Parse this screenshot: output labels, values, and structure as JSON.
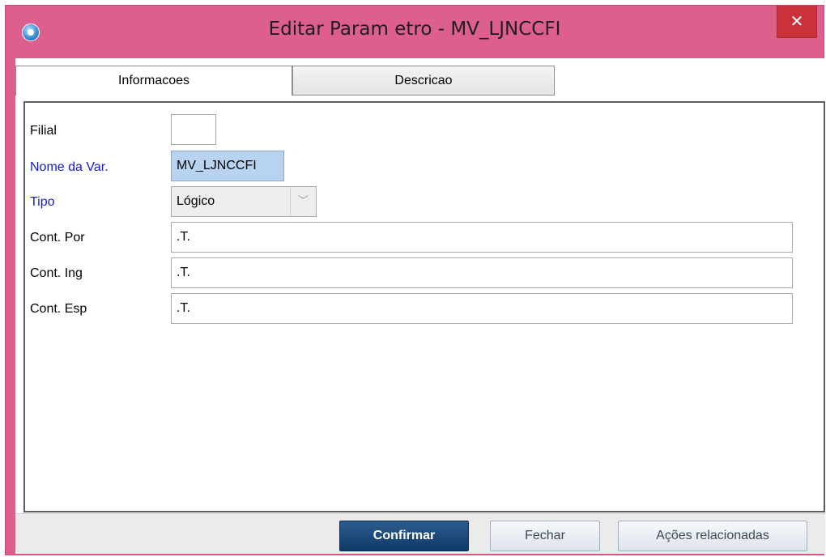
{
  "window": {
    "title": "Editar Param etro - MV_LJNCCFI",
    "close_glyph": "✕"
  },
  "tabs": [
    {
      "label": "Informacoes",
      "active": true
    },
    {
      "label": "Descricao",
      "active": false
    }
  ],
  "form": {
    "filial": {
      "label": "Filial",
      "value": ""
    },
    "nome_var": {
      "label": "Nome da Var.",
      "value": "MV_LJNCCFI"
    },
    "tipo": {
      "label": "Tipo",
      "value": "Lógico"
    },
    "cont_por": {
      "label": "Cont. Por",
      "value": ".T."
    },
    "cont_ing": {
      "label": "Cont. Ing",
      "value": ".T."
    },
    "cont_esp": {
      "label": "Cont. Esp",
      "value": ".T."
    }
  },
  "buttons": {
    "confirmar": "Confirmar",
    "fechar": "Fechar",
    "acoes": "Ações relacionadas"
  },
  "colors": {
    "titlebar": "#dc5f8d",
    "close_button": "#c9323b",
    "required_label": "#1a1ad6",
    "readonly_field": "#b7d3ef",
    "primary_button": "#0f3967"
  },
  "icons": {
    "app": "app-globe-icon",
    "close": "close-icon",
    "dropdown": "chevron-down-icon"
  }
}
